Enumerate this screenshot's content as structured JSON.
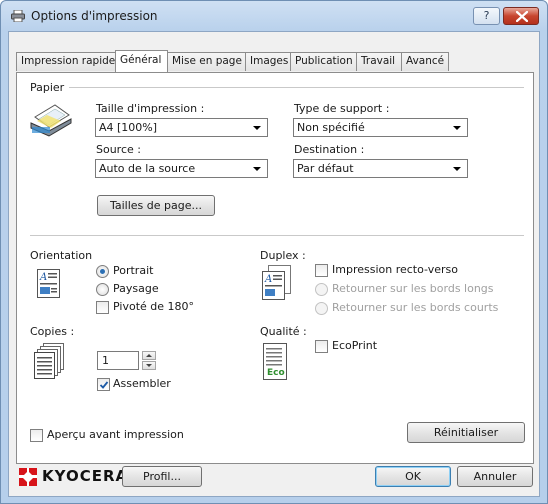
{
  "window": {
    "title": "Options d'impression",
    "help_label": "?"
  },
  "tabs": [
    {
      "label": "Impression rapide",
      "active": false
    },
    {
      "label": "Général",
      "active": true
    },
    {
      "label": "Mise en page",
      "active": false
    },
    {
      "label": "Images",
      "active": false
    },
    {
      "label": "Publication",
      "active": false
    },
    {
      "label": "Travail",
      "active": false
    },
    {
      "label": "Avancé",
      "active": false
    }
  ],
  "paper": {
    "section_label": "Papier",
    "size_label": "Taille d'impression :",
    "size_value": "A4  [100%]",
    "media_type_label": "Type de support :",
    "media_type_value": "Non spécifié",
    "source_label": "Source :",
    "source_value": "Auto de la source",
    "destination_label": "Destination :",
    "destination_value": "Par défaut",
    "page_sizes_button": "Tailles de page..."
  },
  "orientation": {
    "section_label": "Orientation",
    "portrait_label": "Portrait",
    "landscape_label": "Paysage",
    "rotated_label": "Pivoté de 180°",
    "selected": "portrait",
    "rotated_checked": false
  },
  "duplex": {
    "section_label": "Duplex :",
    "duplex_label": "Impression recto-verso",
    "duplex_checked": false,
    "long_edge_label": "Retourner sur les bords longs",
    "short_edge_label": "Retourner sur les bords courts"
  },
  "copies": {
    "section_label": "Copies :",
    "value": "1",
    "collate_label": "Assembler",
    "collate_checked": true
  },
  "quality": {
    "section_label": "Qualité :",
    "ecoprint_label": "EcoPrint",
    "ecoprint_checked": false,
    "eco_icon_text": "Eco"
  },
  "preview": {
    "label": "Aperçu avant impression",
    "checked": false
  },
  "buttons": {
    "reset": "Réinitialiser",
    "profile": "Profil...",
    "ok": "OK",
    "cancel": "Annuler"
  },
  "brand": {
    "name": "KYOCERA",
    "logo_color": "#d7141a"
  }
}
